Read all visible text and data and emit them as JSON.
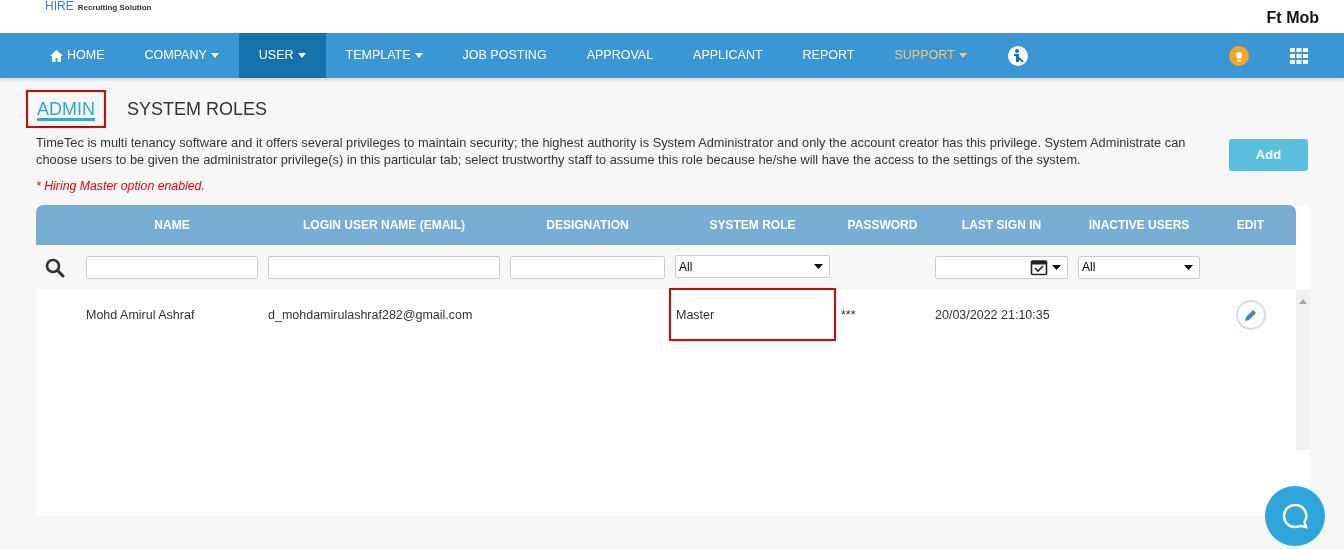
{
  "header": {
    "logo": {
      "brand": "HIRE",
      "tagline": "Recruiting Solution"
    },
    "user_name": "Ft Mob"
  },
  "nav": [
    {
      "label": "HOME",
      "kind": "home",
      "dropdown": false,
      "selected": false,
      "highlighted": false
    },
    {
      "label": "COMPANY",
      "kind": "text",
      "dropdown": true,
      "selected": false,
      "highlighted": false
    },
    {
      "label": "USER",
      "kind": "text",
      "dropdown": true,
      "selected": true,
      "highlighted": false
    },
    {
      "label": "TEMPLATE",
      "kind": "text",
      "dropdown": true,
      "selected": false,
      "highlighted": false
    },
    {
      "label": "JOB POSTING",
      "kind": "text",
      "dropdown": false,
      "selected": false,
      "highlighted": false
    },
    {
      "label": "APPROVAL",
      "kind": "text",
      "dropdown": false,
      "selected": false,
      "highlighted": false
    },
    {
      "label": "APPLICANT",
      "kind": "text",
      "dropdown": false,
      "selected": false,
      "highlighted": false
    },
    {
      "label": "REPORT",
      "kind": "text",
      "dropdown": false,
      "selected": false,
      "highlighted": false
    },
    {
      "label": "SUPPORT",
      "kind": "text",
      "dropdown": true,
      "selected": false,
      "highlighted": true
    },
    {
      "kind": "help"
    }
  ],
  "tabs": [
    {
      "label": "ADMIN",
      "selected": true,
      "annotated": true
    },
    {
      "label": "SYSTEM ROLES",
      "selected": false,
      "annotated": false
    }
  ],
  "description": "TimeTec is multi tenancy software and it offers several privileges to maintain security; the highest authority is System Administrator and only the account creator has this privilege. System Administrate can choose users to be given the administrator privilege(s) in this particular tab; select trustworthy staff to assume this role because he/she will have the access to the settings of the system.",
  "note": "* Hiring Master option enabled.",
  "add_button": "Add",
  "table": {
    "columns": [
      "NAME",
      "LOGIN USER NAME (EMAIL)",
      "DESIGNATION",
      "SYSTEM ROLE",
      "PASSWORD",
      "LAST SIGN IN",
      "INACTIVE USERS",
      "EDIT"
    ],
    "filters": [
      {
        "kind": "text"
      },
      {
        "kind": "text"
      },
      {
        "kind": "text"
      },
      {
        "kind": "select",
        "value": "All"
      },
      {
        "kind": "none"
      },
      {
        "kind": "date"
      },
      {
        "kind": "select",
        "value": "All"
      },
      {
        "kind": "none"
      }
    ],
    "rows": [
      {
        "cells": [
          {
            "text": "Mohd Amirul Ashraf",
            "annotated": false
          },
          {
            "text": "d_mohdamirulashraf282@gmail.com",
            "annotated": false
          },
          {
            "text": "",
            "annotated": false
          },
          {
            "text": "Master",
            "annotated": true
          },
          {
            "text": "***",
            "annotated": false
          },
          {
            "text": "20/03/2022 21:10:35",
            "annotated": false
          },
          {
            "text": "",
            "annotated": false
          },
          {
            "kind": "edit"
          }
        ]
      }
    ]
  }
}
